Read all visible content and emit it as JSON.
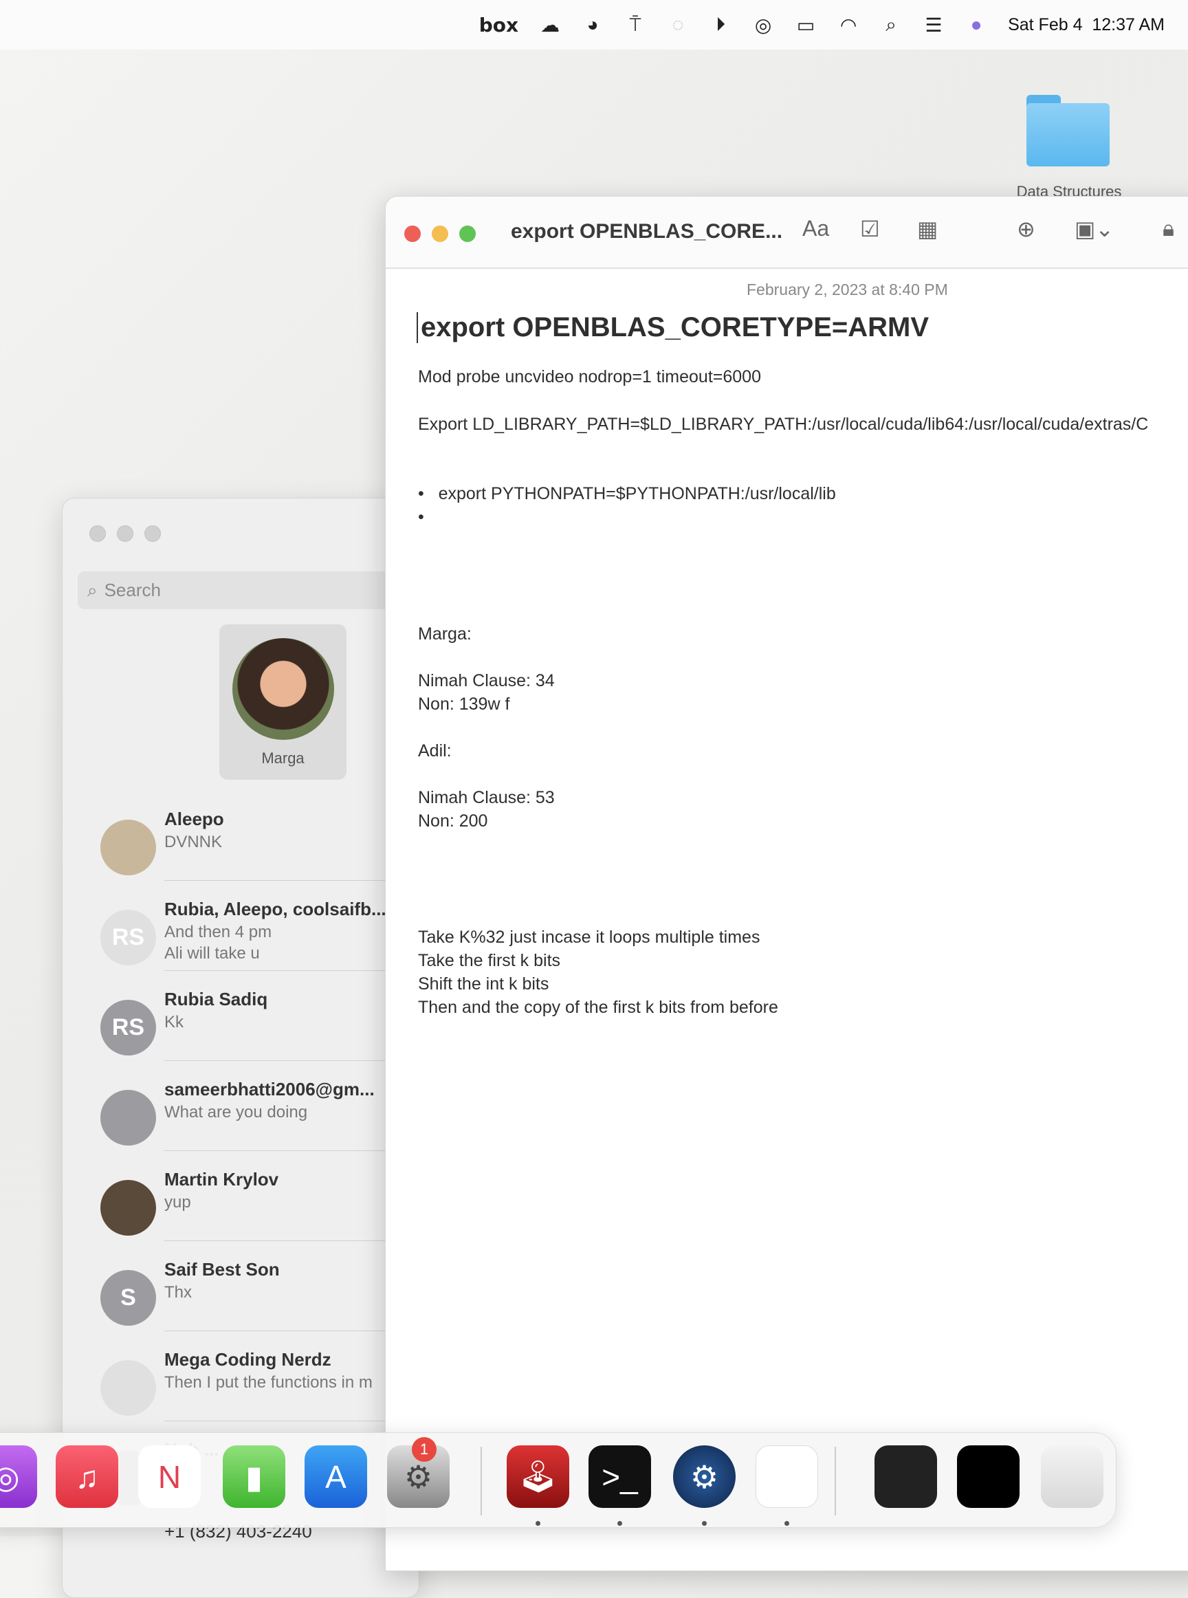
{
  "menubar": {
    "box": "box",
    "icons": [
      "creative-cloud-icon",
      "avast-icon",
      "airpods-icon",
      "sync-icon",
      "play-icon",
      "airdrop-icon",
      "battery-charging-icon",
      "wifi-icon",
      "search-icon",
      "control-center-icon",
      "siri-icon"
    ],
    "datetime": "Sat Feb 4  12:37 AM"
  },
  "desktop": {
    "folder_label": "Data Structures"
  },
  "messages": {
    "search_placeholder": "Search",
    "pinned": {
      "name": "Marga"
    },
    "conversations": [
      {
        "name": "Aleepo",
        "preview": "DVNNK",
        "initials": ""
      },
      {
        "name": "Rubia, Aleepo, coolsaifb...",
        "preview": "And then 4 pm\nAli will take u",
        "initials": "RS"
      },
      {
        "name": "Rubia Sadiq",
        "preview": "Kk",
        "initials": "RS"
      },
      {
        "name": "sameerbhatti2006@gm...",
        "preview": "What are you doing",
        "initials": ""
      },
      {
        "name": "Martin Krylov",
        "preview": "yup",
        "initials": ""
      },
      {
        "name": "Saif Best Son",
        "preview": "Thx",
        "initials": "S"
      },
      {
        "name": "Mega Coding Nerdz",
        "preview": "Then I put the functions in m",
        "initials": ""
      },
      {
        "name": "Nuh ...",
        "preview": "",
        "initials": ""
      }
    ],
    "partial_contact": "+1 (832) 403-2240"
  },
  "notes": {
    "window_title": "export OPENBLAS_CORE...",
    "format_label": "Aa",
    "date": "February 2, 2023 at 8:40 PM",
    "title": "export OPENBLAS_CORETYPE=ARMV",
    "line1": "Mod probe uncvideo nodrop=1 timeout=6000",
    "line2": "Export LD_LIBRARY_PATH=$LD_LIBRARY_PATH:/usr/local/cuda/lib64:/usr/local/cuda/extras/C",
    "bullets": [
      "export PYTHONPATH=$PYTHONPATH:/usr/local/lib",
      ""
    ],
    "marga_label": "Marga:",
    "marga_nimah": "Nimah Clause: 34",
    "marga_non": "Non: 139w f",
    "adil_label": "Adil:",
    "adil_nimah": "Nimah Clause: 53",
    "adil_non": "Non: 200",
    "steps": [
      "Take K%32 just incase it loops multiple times",
      "Take the first k bits",
      "Shift the int k bits",
      "Then and the copy of the first k bits from before"
    ]
  },
  "dock": {
    "apps": [
      "Podcasts",
      "Music",
      "News",
      "Numbers",
      "App Store",
      "System Settings",
      "Joystick app",
      "Terminal",
      "Steam",
      "Document",
      "Terminal window",
      "Chrome window",
      "Trash"
    ],
    "settings_badge": "1"
  }
}
